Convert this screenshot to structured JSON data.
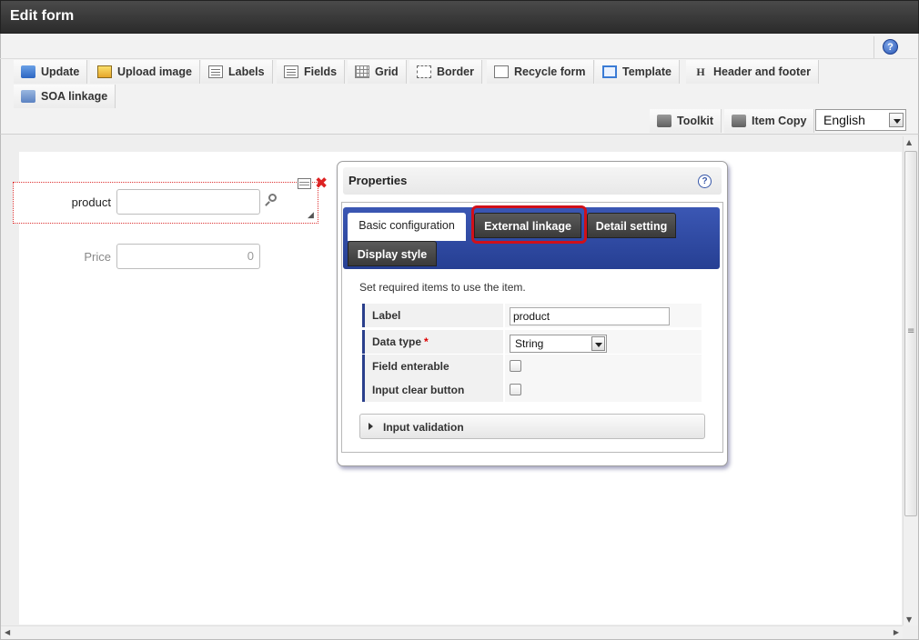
{
  "window": {
    "title": "Edit form"
  },
  "header": {
    "help_label": "?",
    "toolbar": [
      {
        "label": "Update",
        "icon": "update-icon"
      },
      {
        "label": "Upload image",
        "icon": "upload-image-icon"
      },
      {
        "label": "Labels",
        "icon": "labels-icon"
      },
      {
        "label": "Fields",
        "icon": "fields-icon"
      },
      {
        "label": "Grid",
        "icon": "grid-icon"
      },
      {
        "label": "Border",
        "icon": "border-icon"
      },
      {
        "label": "Recycle form",
        "icon": "recycle-form-icon"
      },
      {
        "label": "Template",
        "icon": "template-icon"
      },
      {
        "label": "Header and footer",
        "icon": "header-footer-icon"
      }
    ],
    "toolbar_row2": [
      {
        "label": "SOA linkage",
        "icon": "soa-linkage-icon"
      }
    ],
    "right_tools": [
      {
        "label": "Toolkit",
        "icon": "toolkit-icon"
      },
      {
        "label": "Item Copy",
        "icon": "item-copy-icon"
      }
    ],
    "language": {
      "selected": "English"
    }
  },
  "canvas": {
    "fields": [
      {
        "label": "product",
        "value": ""
      },
      {
        "label": "Price",
        "value": "0"
      }
    ]
  },
  "properties": {
    "title": "Properties",
    "help_label": "?",
    "tabs": [
      {
        "label": "Basic configuration",
        "active": true
      },
      {
        "label": "External linkage",
        "active": false,
        "highlighted": true
      },
      {
        "label": "Detail setting",
        "active": false
      },
      {
        "label": "Display style",
        "active": false
      }
    ],
    "note": "Set required items to use the item.",
    "rows": [
      {
        "label": "Label",
        "value": "product"
      },
      {
        "label": "Data type",
        "required_mark": "*",
        "value": "String"
      },
      {
        "label": "Field enterable",
        "checked": false
      },
      {
        "label": "Input clear button",
        "checked": false
      }
    ],
    "input_validation": "Input validation"
  },
  "colors": {
    "titlebar": "#2b2b2b",
    "tab_panel": "#263f93",
    "highlight": "#d0101a",
    "selection_border": "#dd3333"
  }
}
